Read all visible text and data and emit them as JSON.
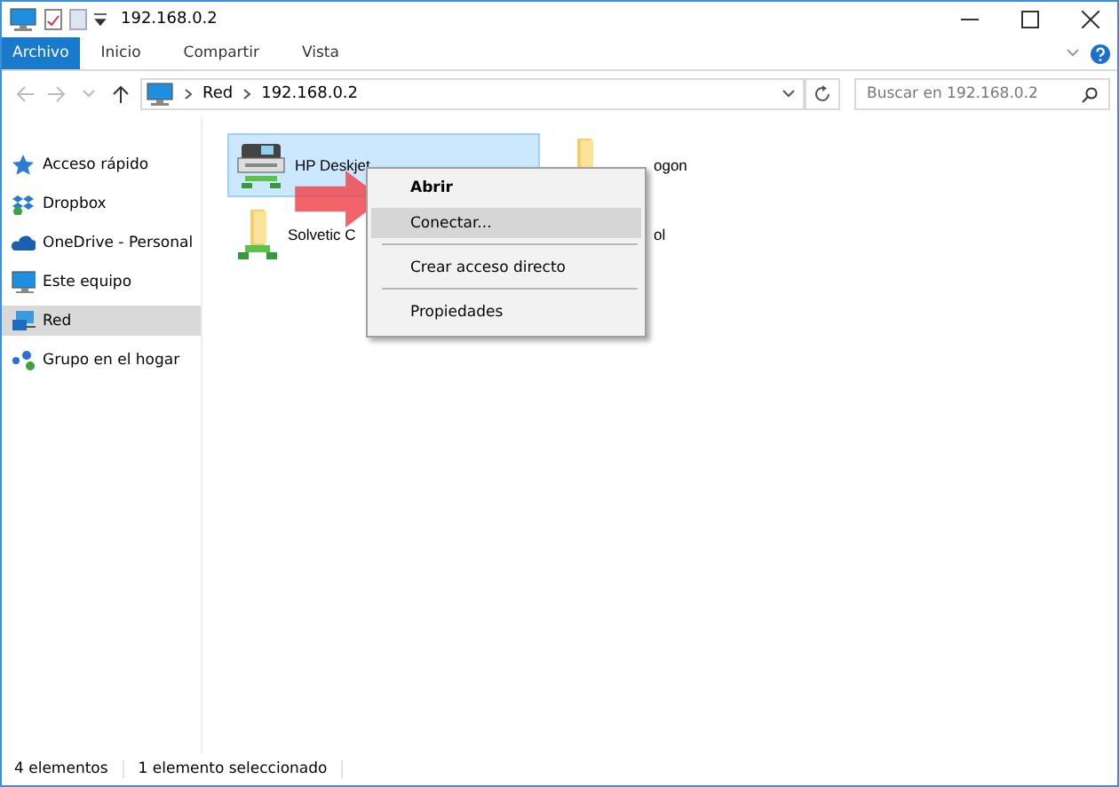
{
  "window": {
    "title": "192.168.0.2"
  },
  "ribbon_tabs": [
    {
      "label": "Archivo",
      "kind": "file"
    },
    {
      "label": "Inicio",
      "kind": "tab"
    },
    {
      "label": "Compartir",
      "kind": "tab"
    },
    {
      "label": "Vista",
      "kind": "tab"
    }
  ],
  "address": {
    "crumbs": [
      "Red",
      "192.168.0.2"
    ]
  },
  "search": {
    "placeholder": "Buscar en 192.168.0.2"
  },
  "sidebar": {
    "items": [
      {
        "label": "Acceso rápido",
        "kind": "star",
        "selected": false
      },
      {
        "label": "Dropbox",
        "kind": "dropbox",
        "selected": false
      },
      {
        "label": "OneDrive - Personal",
        "kind": "cloud",
        "selected": false
      },
      {
        "label": "Este equipo",
        "kind": "pc",
        "selected": false
      },
      {
        "label": "Red",
        "kind": "network",
        "selected": true
      },
      {
        "label": "Grupo en el hogar",
        "kind": "homegroup",
        "selected": false
      }
    ]
  },
  "items": [
    {
      "label": "HP Deskjet",
      "kind": "printer",
      "selected": true
    },
    {
      "label": "ogon",
      "kind": "folder",
      "selected": false
    },
    {
      "label": "Solvetic C",
      "kind": "network-folder",
      "selected": false
    },
    {
      "label": "ol",
      "selected": false
    }
  ],
  "context_menu": [
    {
      "label": "Abrir",
      "default": true,
      "selected": false
    },
    {
      "label": "Conectar...",
      "default": false,
      "selected": true
    },
    {
      "kind": "separator"
    },
    {
      "label": "Crear acceso directo",
      "default": false,
      "selected": false
    },
    {
      "kind": "separator"
    },
    {
      "label": "Propiedades",
      "default": false,
      "selected": false
    }
  ],
  "status_bar": [
    "4 elementos",
    "1 elemento seleccionado"
  ]
}
